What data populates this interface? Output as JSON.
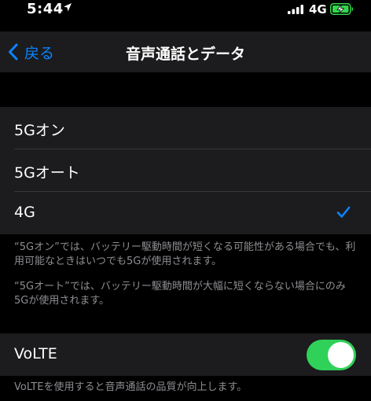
{
  "status_bar": {
    "time": "5:44",
    "network": "4G",
    "battery_color": "#32d74b",
    "icons": [
      "location-arrow-icon",
      "cellular-signal-icon",
      "battery-charging-icon"
    ]
  },
  "nav": {
    "back_label": "戻る",
    "title": "音声通話とデータ",
    "accent_color": "#0a84ff"
  },
  "network_options": {
    "items": [
      {
        "label": "5Gオン",
        "selected": false
      },
      {
        "label": "5Gオート",
        "selected": false
      },
      {
        "label": "4G",
        "selected": true
      }
    ],
    "footnote_1": "“5Gオン”では、バッテリー駆動時間が短くなる可能性がある場合でも、利用可能なときはいつでも5Gが使用されます。",
    "footnote_2": "“5Gオート”では、バッテリー駆動時間が大幅に短くならない場合にのみ5Gが使用されます。"
  },
  "volte": {
    "label": "VoLTE",
    "enabled": true,
    "toggle_color": "#30d158",
    "footnote": "VoLTEを使用すると音声通話の品質が向上します。"
  }
}
